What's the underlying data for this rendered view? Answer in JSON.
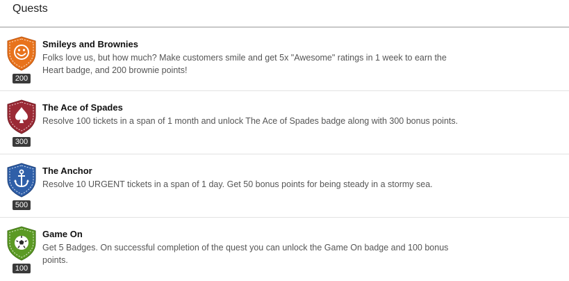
{
  "header": {
    "title": "Quests"
  },
  "quests": [
    {
      "title": "Smileys and Brownies",
      "description": "Folks love us, but how much? Make customers smile and get 5x \"Awesome\" ratings in 1 week to earn the Heart badge, and 200 brownie points!",
      "points": "200",
      "badge_icon": "smiley-icon",
      "badge_color": "#e8731c"
    },
    {
      "title": "The Ace of Spades",
      "description": "Resolve 100 tickets in a span of 1 month and unlock The Ace of Spades badge along with 300 bonus points.",
      "points": "300",
      "badge_icon": "spade-icon",
      "badge_color": "#9b2a35"
    },
    {
      "title": "The Anchor",
      "description": "Resolve 10 URGENT tickets in a span of 1 day. Get 50 bonus points for being steady in a stormy sea.",
      "points": "500",
      "badge_icon": "anchor-icon",
      "badge_color": "#2f5fa8"
    },
    {
      "title": "Game On",
      "description": "Get 5 Badges. On successful completion of the quest you can unlock the Game On badge and 100 bonus points.",
      "points": "100",
      "badge_icon": "soccer-ball-icon",
      "badge_color": "#5b9a24"
    }
  ]
}
